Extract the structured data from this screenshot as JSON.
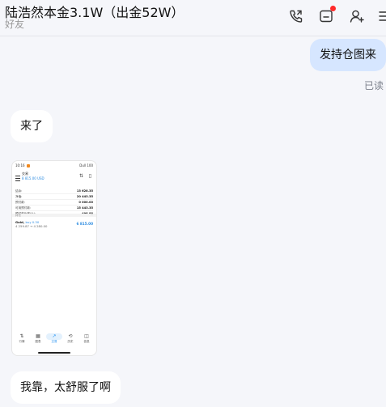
{
  "header": {
    "title": "陆浩然本金3.1W（出金52W）",
    "subtitle": "好友"
  },
  "messages": {
    "m1": "发持仓图来",
    "read": "已读",
    "m2": "来了",
    "m3": "我靠，太舒服了啊"
  },
  "screenshot": {
    "status_time": "10:16",
    "status_right": "Dull 100",
    "account_name": "交易",
    "balance": "8 815.00 USD",
    "rows": [
      {
        "k": "结余:",
        "v": "13 628.35"
      },
      {
        "k": "净值:",
        "v": "20 443.35"
      },
      {
        "k": "预付款:",
        "v": "0 000.00"
      },
      {
        "k": "可用预付款:",
        "v": "15 443.35"
      },
      {
        "k": "预付款比率(%):",
        "v": "498.88"
      }
    ],
    "section_label": "持仓",
    "section_more": "···",
    "trade": {
      "symbol": "Gold,",
      "side": "buy 0.30",
      "prices": "4 259.87 → 4 280.00",
      "pl": "6 815.00"
    },
    "nav": [
      {
        "label": "行情",
        "glyph": "⇅"
      },
      {
        "label": "图表",
        "glyph": "▦"
      },
      {
        "label": "交易",
        "glyph": "↗"
      },
      {
        "label": "历史",
        "glyph": "⟲"
      },
      {
        "label": "信息",
        "glyph": "◫"
      }
    ]
  },
  "colors": {
    "background": "#f5f6fa",
    "bubble_self": "#d6e6ff",
    "bubble_other": "#ffffff",
    "notification_dot": "#ff2a2a",
    "accent_blue": "#2a8ae0"
  },
  "icons": [
    "phone-call-icon",
    "message-box-icon",
    "add-friend-icon",
    "menu-icon"
  ]
}
